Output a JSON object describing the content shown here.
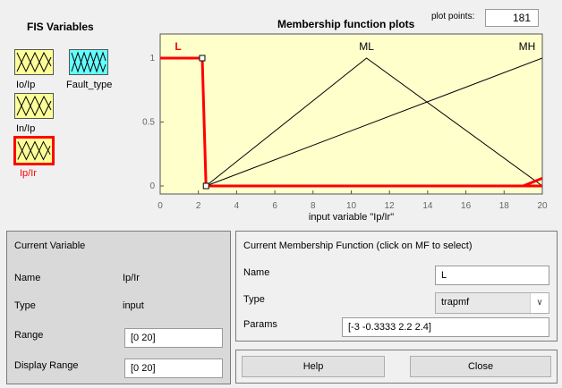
{
  "fis_variables": {
    "title": "FIS Variables",
    "items": [
      {
        "label": "Io/Ip",
        "kind": "input",
        "selected": false
      },
      {
        "label": "Fault_type",
        "kind": "output",
        "selected": false
      },
      {
        "label": "In/Ip",
        "kind": "input",
        "selected": false
      },
      {
        "label": "Ip/Ir",
        "kind": "input",
        "selected": true
      }
    ]
  },
  "plot": {
    "title": "Membership function plots",
    "plot_points_label": "plot points:",
    "plot_points_value": "181",
    "xlabel": "input variable \"Ip/Ir\""
  },
  "chart_data": {
    "type": "line",
    "xlim": [
      0,
      20
    ],
    "ylim": [
      0,
      1
    ],
    "x_ticks": [
      "0",
      "2",
      "4",
      "6",
      "8",
      "10",
      "12",
      "14",
      "16",
      "18",
      "20"
    ],
    "y_ticks": [
      "0",
      "0.5",
      "1"
    ],
    "xlabel": "input variable \"Ip/Ir\"",
    "series": [
      {
        "name": "L",
        "selected": true,
        "color": "#ff0000",
        "points": [
          [
            -3,
            1
          ],
          [
            2.2,
            1
          ],
          [
            2.4,
            0
          ],
          [
            20,
            0
          ]
        ]
      },
      {
        "name": "ML",
        "selected": false,
        "color": "#000000",
        "points": [
          [
            2.4,
            0
          ],
          [
            10.8,
            1
          ],
          [
            20,
            0
          ]
        ]
      },
      {
        "name": "MH",
        "selected": false,
        "color": "#000000",
        "points": [
          [
            2.4,
            0
          ],
          [
            20,
            1
          ]
        ]
      },
      {
        "name": "",
        "selected": false,
        "color": "#ff0000",
        "points": [
          [
            19,
            0
          ],
          [
            20,
            0.06
          ]
        ]
      }
    ]
  },
  "current_variable": {
    "title": "Current Variable",
    "name_label": "Name",
    "name_value": "Ip/Ir",
    "type_label": "Type",
    "type_value": "input",
    "range_label": "Range",
    "range_value": "[0 20]",
    "display_range_label": "Display Range",
    "display_range_value": "[0 20]"
  },
  "current_mf": {
    "title": "Current Membership Function (click on MF to select)",
    "name_label": "Name",
    "name_value": "L",
    "type_label": "Type",
    "type_value": "trapmf",
    "params_label": "Params",
    "params_value": "[-3 -0.3333 2.2 2.4]"
  },
  "buttons": {
    "help": "Help",
    "close": "Close"
  },
  "colors": {
    "plot_bg": "#ffffcc",
    "input_icon": "#ffff99",
    "output_icon": "#66ffff",
    "selected": "#ff0000"
  }
}
